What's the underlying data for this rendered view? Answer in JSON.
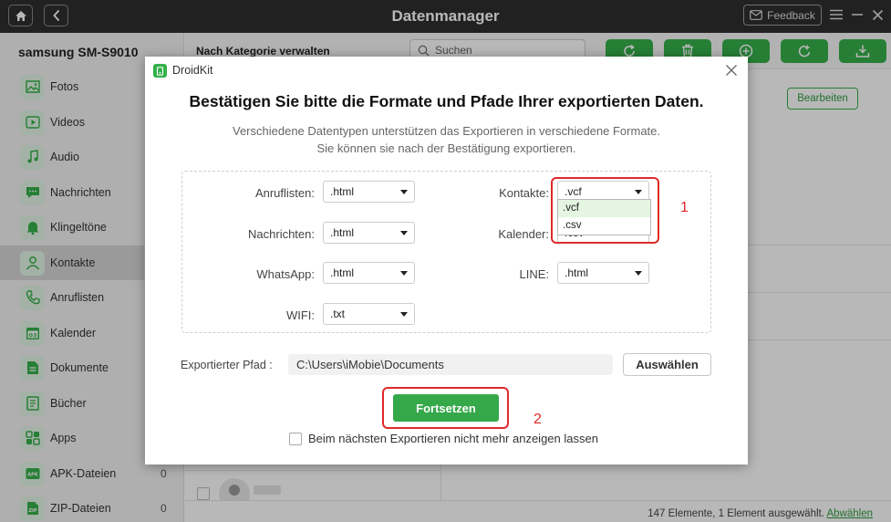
{
  "window": {
    "title": "Datenmanager",
    "feedback_label": "Feedback"
  },
  "sidebar": {
    "device_name": "samsung SM-S9010",
    "items": [
      {
        "label": "Fotos",
        "icon": "photo-icon",
        "count": ""
      },
      {
        "label": "Videos",
        "icon": "video-icon",
        "count": ""
      },
      {
        "label": "Audio",
        "icon": "music-icon",
        "count": ""
      },
      {
        "label": "Nachrichten",
        "icon": "message-icon",
        "count": ""
      },
      {
        "label": "Klingeltöne",
        "icon": "bell-icon",
        "count": ""
      },
      {
        "label": "Kontakte",
        "icon": "contact-icon",
        "count": ""
      },
      {
        "label": "Anruflisten",
        "icon": "phone-icon",
        "count": ""
      },
      {
        "label": "Kalender",
        "icon": "calendar-icon",
        "count": ""
      },
      {
        "label": "Dokumente",
        "icon": "document-icon",
        "count": ""
      },
      {
        "label": "Bücher",
        "icon": "book-icon",
        "count": ""
      },
      {
        "label": "Apps",
        "icon": "apps-icon",
        "count": ""
      },
      {
        "label": "APK-Dateien",
        "icon": "apk-icon",
        "count": "0"
      },
      {
        "label": "ZIP-Dateien",
        "icon": "zip-icon",
        "count": "0"
      }
    ]
  },
  "main": {
    "category_label": "Nach Kategorie verwalten",
    "search_placeholder": "Suchen",
    "edit_button": "Bearbeiten",
    "status_text": "147 Elemente, 1 Element ausgewählt.",
    "deselect_link": "Abwählen"
  },
  "dialog": {
    "app_name": "DroidKit",
    "title": "Bestätigen Sie bitte die Formate und Pfade Ihrer exportierten Daten.",
    "subtitle": "Verschiedene Datentypen unterstützen das Exportieren in verschiedene Formate. Sie können sie nach der Bestätigung exportieren.",
    "formats": {
      "anruflisten": {
        "label": "Anruflisten:",
        "value": ".html"
      },
      "nachrichten": {
        "label": "Nachrichten:",
        "value": ".html"
      },
      "whatsapp": {
        "label": "WhatsApp:",
        "value": ".html"
      },
      "wifi": {
        "label": "WIFI:",
        "value": ".txt"
      },
      "kontakte": {
        "label": "Kontakte:",
        "value": ".vcf"
      },
      "kalender": {
        "label": "Kalender:",
        "value": ".csv"
      },
      "line": {
        "label": "LINE:",
        "value": ".html"
      }
    },
    "kontakte_dropdown_options": [
      ".vcf",
      ".csv"
    ],
    "path_label": "Exportierter Pfad :",
    "path_value": "C:\\Users\\iMobie\\Documents",
    "choose_button": "Auswählen",
    "continue_button": "Fortsetzen",
    "dont_show_label": "Beim nächsten Exportieren nicht mehr anzeigen lassen",
    "annotation_1": "1",
    "annotation_2": "2"
  },
  "colors": {
    "accent": "#35b04a",
    "annotation": "#e02a2a",
    "titlebar": "#2f2f2f"
  }
}
